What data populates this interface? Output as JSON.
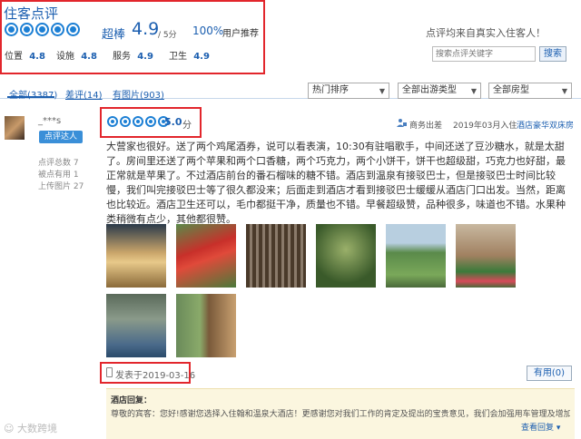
{
  "header": {
    "title": "住客点评",
    "rating_word": "超棒",
    "score": "4.9",
    "score_unit": "/ 5分",
    "recommend_pct": "100%",
    "recommend_label": "用户推荐",
    "sub_scores": [
      {
        "label": "位置",
        "value": "4.8"
      },
      {
        "label": "设施",
        "value": "4.8"
      },
      {
        "label": "服务",
        "value": "4.9"
      },
      {
        "label": "卫生",
        "value": "4.9"
      }
    ],
    "guarantee": "点评均来自真实入住客人！",
    "search_placeholder": "搜索点评关键字",
    "search_button": "搜索"
  },
  "tabs": [
    {
      "label": "全部(3387)"
    },
    {
      "label": "差评(14)"
    },
    {
      "label": "有图片(903)"
    }
  ],
  "filters": {
    "sort": "热门排序",
    "travel_type": "全部出游类型",
    "room_type": "全部房型"
  },
  "review": {
    "user": {
      "name": "_***s",
      "badge": "点评达人",
      "stats": [
        "点评总数 7",
        "被点有用 1",
        "上传图片 27"
      ]
    },
    "score": "5.0",
    "score_unit": "分",
    "trip_type": "商务出差",
    "stay_date": "2019年03月入住",
    "room": "酒店豪华双床房",
    "text": "大营家也很好。送了两个鸡尾酒券，说可以看表演，10:30有驻唱歌手，中间还送了豆沙糖水，就是太甜了。房间里还送了两个苹果和两个口香糖，两个巧克力，两个小饼干，饼干也超级甜，巧克力也好甜，最正常就是苹果了。不过酒店前台的番石榴味的糖不错。酒店到温泉有接驳巴士，但是接驳巴士时间比较慢，我们叫完接驳巴士等了很久都没来；后面走到酒店才看到接驳巴士缓缓从酒店门口出发。当然，距离也比较近。酒店卫生还可以，毛巾都挺干净，质量也不错。早餐超级赞，品种很多，味道也不错。水果种类稍微有点少，其他都很赞。",
    "posted": "发表于2019-03-16",
    "helpful_button": "有用(0)"
  },
  "hotel_reply": {
    "title": "酒店回复：",
    "text": "尊敬的宾客：您好!感谢您选择入住翰和温泉大酒店！更感谢您对我们工作的肯定及提出的宝贵意见，我们会加强用车管理及增加",
    "more": "查看回复 ▾"
  },
  "watermark": "大数跨境"
}
